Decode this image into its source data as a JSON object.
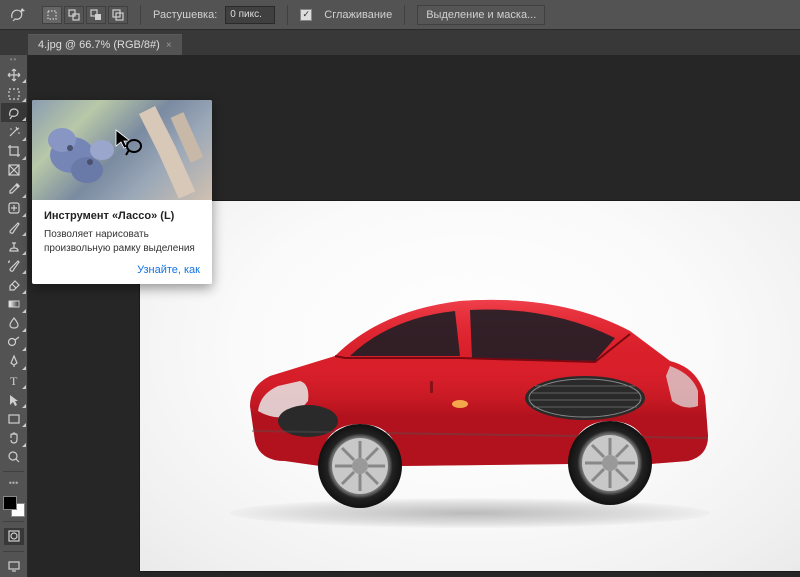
{
  "options_bar": {
    "feather_label": "Растушевка:",
    "feather_value": "0 пикс.",
    "antialias_label": "Сглаживание",
    "refine_label": "Выделение и маска..."
  },
  "tab": {
    "title": "4.jpg @ 66.7% (RGB/8#)",
    "close": "×"
  },
  "toolbar": {
    "tools": [
      {
        "name": "move-tool"
      },
      {
        "name": "marquee-tool"
      },
      {
        "name": "lasso-tool",
        "active": true
      },
      {
        "name": "magic-wand-tool"
      },
      {
        "name": "crop-tool"
      },
      {
        "name": "frame-tool"
      },
      {
        "name": "eyedropper-tool"
      },
      {
        "name": "healing-brush-tool"
      },
      {
        "name": "brush-tool"
      },
      {
        "name": "clone-stamp-tool"
      },
      {
        "name": "history-brush-tool"
      },
      {
        "name": "eraser-tool"
      },
      {
        "name": "gradient-tool"
      },
      {
        "name": "blur-tool"
      },
      {
        "name": "dodge-tool"
      },
      {
        "name": "pen-tool"
      },
      {
        "name": "type-tool"
      },
      {
        "name": "path-selection-tool"
      },
      {
        "name": "rectangle-tool"
      },
      {
        "name": "hand-tool"
      },
      {
        "name": "zoom-tool"
      }
    ]
  },
  "tooltip": {
    "title": "Инструмент «Лассо» (L)",
    "description": "Позволяет нарисовать произвольную рамку выделения",
    "link": "Узнайте, как"
  }
}
